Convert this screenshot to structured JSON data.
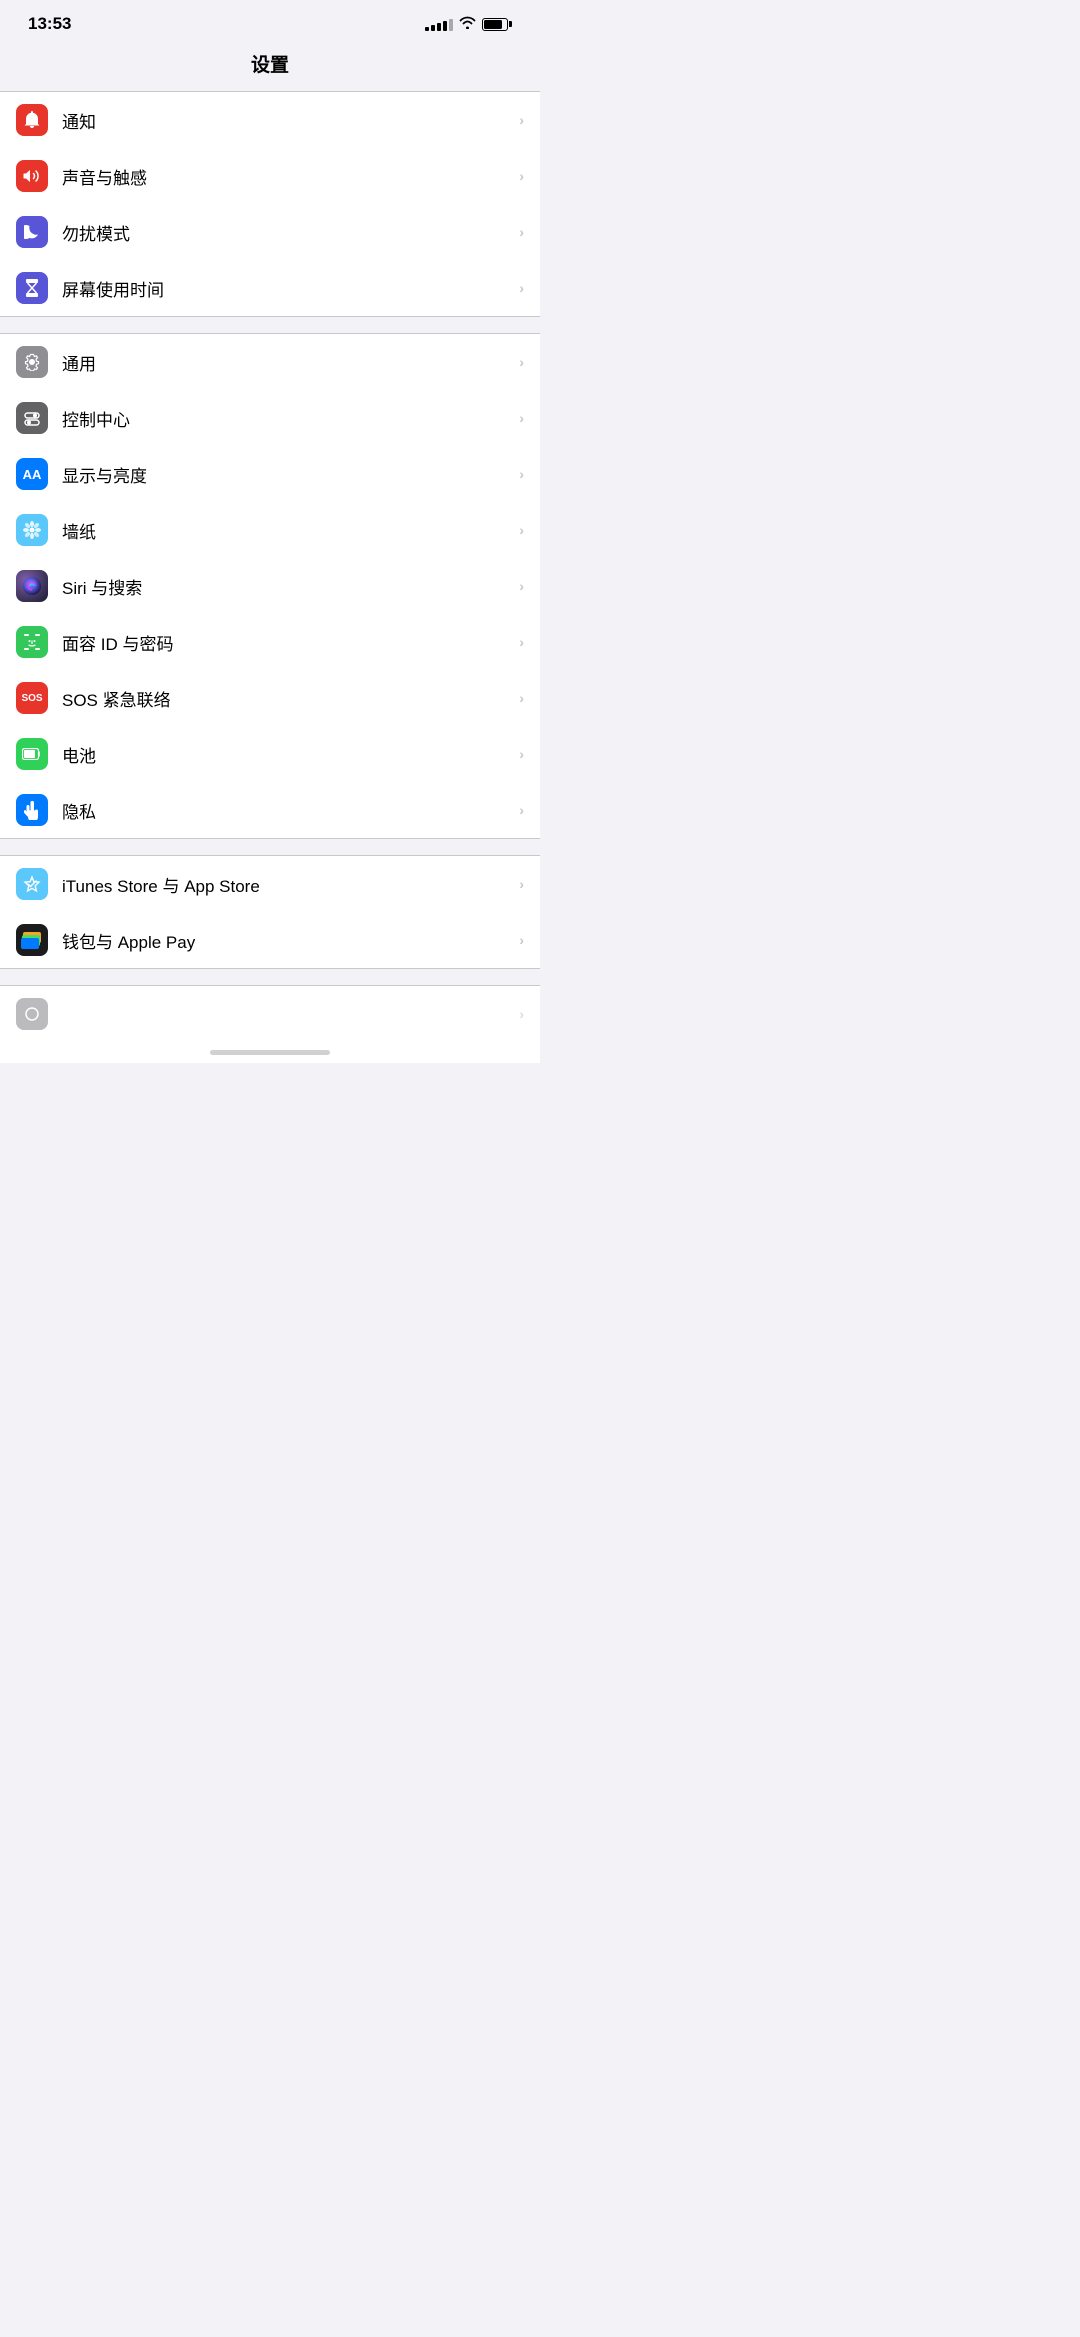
{
  "statusBar": {
    "time": "13:53",
    "signalBars": [
      4,
      6,
      8,
      10,
      12
    ],
    "wifi": true,
    "battery": 80
  },
  "pageTitle": "设置",
  "sections": [
    {
      "id": "notifications",
      "items": [
        {
          "id": "notification",
          "icon": "bell-icon",
          "iconBg": "red",
          "label": "通知"
        },
        {
          "id": "sound",
          "icon": "speaker-icon",
          "iconBg": "red2",
          "label": "声音与触感"
        },
        {
          "id": "dnd",
          "icon": "moon-icon",
          "iconBg": "indigo",
          "label": "勿扰模式"
        },
        {
          "id": "screentime",
          "icon": "hourglass-icon",
          "iconBg": "purple",
          "label": "屏幕使用时间"
        }
      ]
    },
    {
      "id": "system",
      "items": [
        {
          "id": "general",
          "icon": "gear-icon",
          "iconBg": "gray",
          "label": "通用"
        },
        {
          "id": "control",
          "icon": "toggle-icon",
          "iconBg": "gray2",
          "label": "控制中心"
        },
        {
          "id": "display",
          "icon": "aa-icon",
          "iconBg": "blue",
          "label": "显示与亮度"
        },
        {
          "id": "wallpaper",
          "icon": "flower-icon",
          "iconBg": "teal",
          "label": "墙纸"
        },
        {
          "id": "siri",
          "icon": "siri-icon",
          "iconBg": "siri",
          "label": "Siri 与搜索"
        },
        {
          "id": "faceid",
          "icon": "faceid-icon",
          "iconBg": "green",
          "label": "面容 ID 与密码"
        },
        {
          "id": "sos",
          "icon": "sos-icon",
          "iconBg": "red",
          "label": "SOS 紧急联络"
        },
        {
          "id": "battery",
          "icon": "battery-icon",
          "iconBg": "green2",
          "label": "电池"
        },
        {
          "id": "privacy",
          "icon": "hand-icon",
          "iconBg": "blue",
          "label": "隐私"
        }
      ]
    },
    {
      "id": "store",
      "items": [
        {
          "id": "itunes",
          "icon": "appstore-icon",
          "iconBg": "lightblue",
          "label": "iTunes Store 与 App Store"
        },
        {
          "id": "wallet",
          "icon": "wallet-icon",
          "iconBg": "black",
          "label": "钱包与 Apple Pay"
        }
      ]
    }
  ],
  "bottomPartial": {
    "visible": true,
    "iconBg": "gray"
  }
}
